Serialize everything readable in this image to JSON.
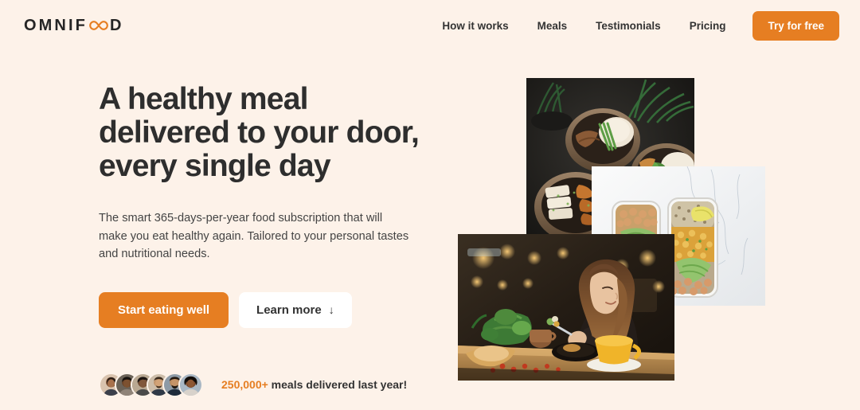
{
  "brand": {
    "name_part1": "OMNIF",
    "name_part2": "D",
    "infinity_icon": "infinity-icon",
    "accent_color": "#e67e22",
    "text_color": "#252525"
  },
  "background_color": "#fdf2e9",
  "nav": {
    "items": [
      {
        "label": "How it works"
      },
      {
        "label": "Meals"
      },
      {
        "label": "Testimonials"
      },
      {
        "label": "Pricing"
      }
    ],
    "cta_label": "Try for free"
  },
  "hero": {
    "headline_lines": [
      "A healthy meal",
      "delivered to your door,",
      "every single day"
    ],
    "description_lines": [
      "The smart 365-days-per-year food subscription that will",
      "make you eat healthy again. Tailored to your personal tastes",
      "and nutritional needs."
    ],
    "primary_cta": "Start eating well",
    "secondary_cta": "Learn more",
    "secondary_cta_arrow": "↓",
    "delivered": {
      "count": "250,000+",
      "text": " meals delivered last year!",
      "avatar_count": 6,
      "avatars": [
        {
          "name": "customer-avatar-1"
        },
        {
          "name": "customer-avatar-2"
        },
        {
          "name": "customer-avatar-3"
        },
        {
          "name": "customer-avatar-4"
        },
        {
          "name": "customer-avatar-5"
        },
        {
          "name": "customer-avatar-6"
        }
      ]
    },
    "images": [
      {
        "name": "meal-bowls-photo",
        "alt": "Three dark bowls of rice, greens and grilled meat on a black table with plants"
      },
      {
        "name": "meal-prep-photo",
        "alt": "Two meal-prep containers with chickpeas, avocado and lime on white marble"
      },
      {
        "name": "woman-eating-photo",
        "alt": "Woman smiling while eating a salad at a warmly lit restaurant table"
      }
    ]
  }
}
